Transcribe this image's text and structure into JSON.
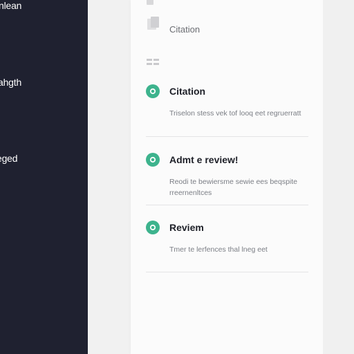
{
  "sidebar": {
    "items": [
      {
        "label": "nlean"
      },
      {
        "label": "ahgth"
      },
      {
        "label": "eged"
      }
    ]
  },
  "header": {
    "title": "Citation"
  },
  "steps": [
    {
      "title": "Citation",
      "description": "Triselon stess vek tof looq eet regruerratt",
      "status": "complete"
    },
    {
      "title": "Admt e review!",
      "description": "Reodi te bewiersme sewie ees beqspite rreernenltces",
      "status": "complete"
    },
    {
      "title": "Reviem",
      "description": "Tmer te lerfences thal lneg eet",
      "status": "complete"
    }
  ],
  "colors": {
    "sidebar": "#1f2130",
    "accent": "#3db38d",
    "panel": "#fbfbfb"
  },
  "icons": [
    "page-icon",
    "doc-icon",
    "list-icon",
    "check-icon"
  ]
}
